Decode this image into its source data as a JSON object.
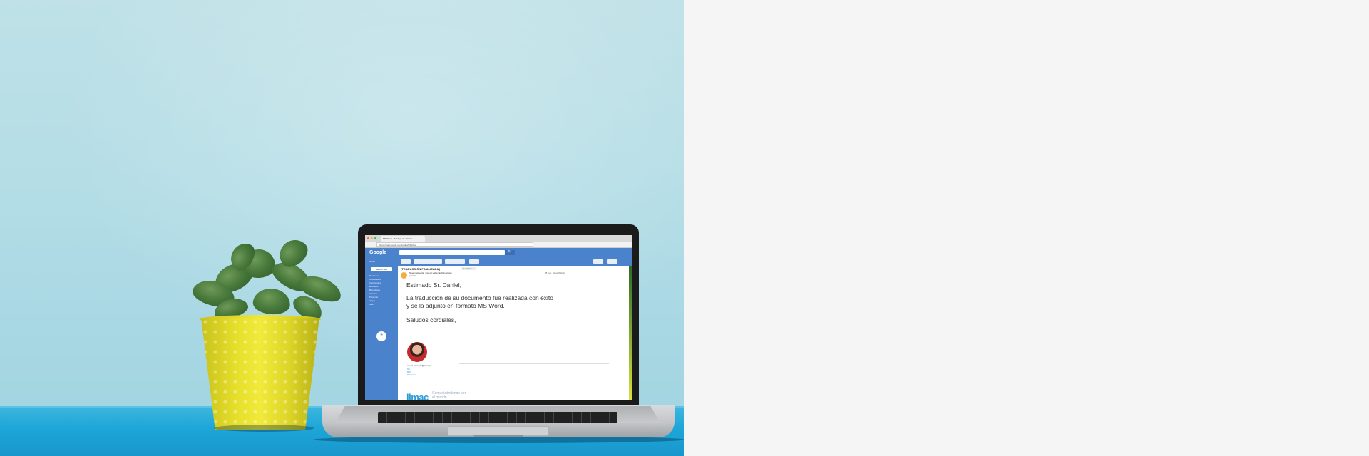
{
  "browser": {
    "tab_title": "MS Word - Bandeja de entrada",
    "url": "https://mail.google.com/mail/u/0/#inbox"
  },
  "gmail": {
    "logo": "Google",
    "app_label": "Gmail",
    "compose_label": "REDACTAR",
    "sidebar_items": [
      "Recibidos",
      "Destacados",
      "Importantes",
      "Enviados",
      "Borradores",
      "Círculos",
      "Personal",
      "Viajes",
      "Más"
    ],
    "search_button": "🔍"
  },
  "email": {
    "subject": "[TRADUCCIÓN FINALIZADA]",
    "subject_badge": "Recibidos ×",
    "sender": "Noemi Valverde <noemi.valverde@limac.pe>",
    "recipient": "para mí",
    "datetime": "28 mar. (hace 8 días)",
    "greeting": "Estimado Sr. Daniel,",
    "body_line1": "La traducción de su documento fue realizada con éxito",
    "body_line2": "y se la adjunto en formato MS Word.",
    "closing": "Saludos cordiales,",
    "signature_email": "noemi.valverde@limac.pe",
    "signature_line1": "Tel.",
    "signature_line2": "RPC",
    "signature_line3": "Dirección",
    "signature_logo": "limac",
    "signature_tagline": "Comunicándonos con el mundo"
  }
}
